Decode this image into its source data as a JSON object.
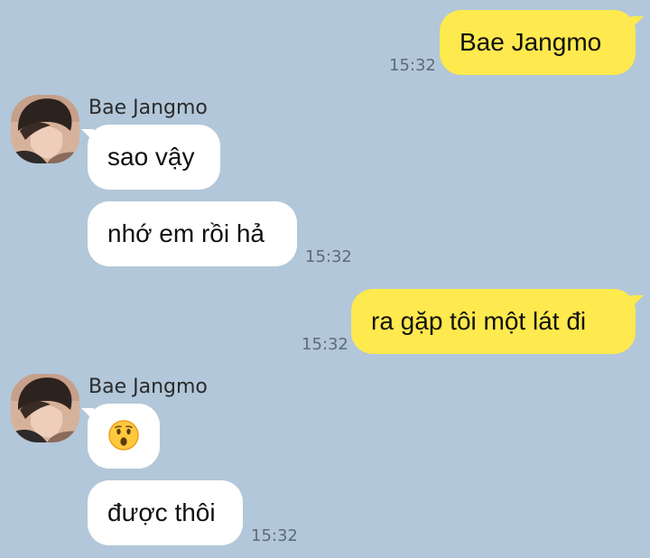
{
  "conversation": {
    "messages": [
      {
        "direction": "outgoing",
        "text": "Bae Jangmo",
        "time": "15:32"
      },
      {
        "direction": "incoming",
        "sender": "Bae Jangmo",
        "text": "sao vậy"
      },
      {
        "direction": "incoming",
        "text": "nhớ em rồi hả",
        "time": "15:32"
      },
      {
        "direction": "outgoing",
        "text": "ra gặp tôi một lát đi",
        "time": "15:32"
      },
      {
        "direction": "incoming",
        "sender": "Bae Jangmo",
        "emoji": "hushed-face"
      },
      {
        "direction": "incoming",
        "text": "được thôi",
        "time": "15:32"
      }
    ]
  },
  "colors": {
    "background": "#b2c7d9",
    "outgoing_bubble": "#fee94e",
    "incoming_bubble": "#ffffff"
  }
}
